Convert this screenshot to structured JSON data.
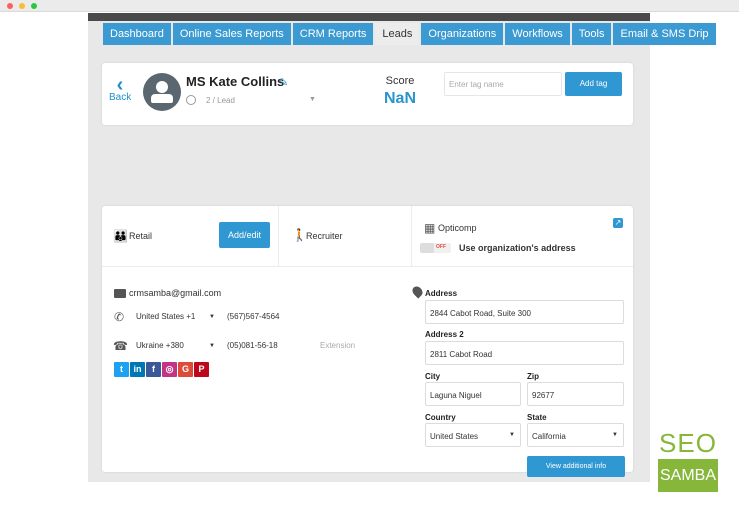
{
  "nav": {
    "tabs": [
      {
        "label": "Dashboard",
        "active": false
      },
      {
        "label": "Online Sales Reports",
        "active": false
      },
      {
        "label": "CRM Reports",
        "active": false
      },
      {
        "label": "Leads",
        "active": true
      },
      {
        "label": "Organizations",
        "active": false
      },
      {
        "label": "Workflows",
        "active": false
      },
      {
        "label": "Tools",
        "active": false
      },
      {
        "label": "Email & SMS Drip",
        "active": false
      }
    ]
  },
  "header": {
    "back_label": "Back",
    "lead_name": "MS Kate Collins",
    "lead_status": "2 / Lead",
    "score_label": "Score",
    "score_value": "NaN",
    "tag_placeholder": "Enter tag name",
    "add_tag_label": "Add tag"
  },
  "sections": {
    "retail_label": "Retail",
    "add_edit_label": "Add/edit",
    "recruiter_label": "Recruiter",
    "opticomp_label": "Opticomp",
    "toggle_state": "OFF",
    "use_org_address_label": "Use organization's address"
  },
  "contact": {
    "email": "crmsamba@gmail.com",
    "phone1_country": "United States +1",
    "phone1_number": "(567)567-4564",
    "phone2_country": "Ukraine +380",
    "phone2_number": "(05)081-56-18",
    "extension_placeholder": "Extension",
    "social_icons": [
      "twitter-icon",
      "linkedin-icon",
      "facebook-icon",
      "instagram-icon",
      "google-plus-icon",
      "pinterest-icon"
    ]
  },
  "address": {
    "address_label": "Address",
    "address_value": "2844 Cabot Road, Suite 300",
    "address2_label": "Address 2",
    "address2_value": "2811 Cabot Road",
    "city_label": "City",
    "city_value": "Laguna Niguel",
    "zip_label": "Zip",
    "zip_value": "92677",
    "country_label": "Country",
    "country_value": "United States",
    "state_label": "State",
    "state_value": "California",
    "view_info_label": "View additional info"
  },
  "branding": {
    "seo_top": "SEO",
    "seo_bottom": "SAMBA",
    "accent_color": "#2f97d1",
    "brand_green": "#86b73b"
  }
}
